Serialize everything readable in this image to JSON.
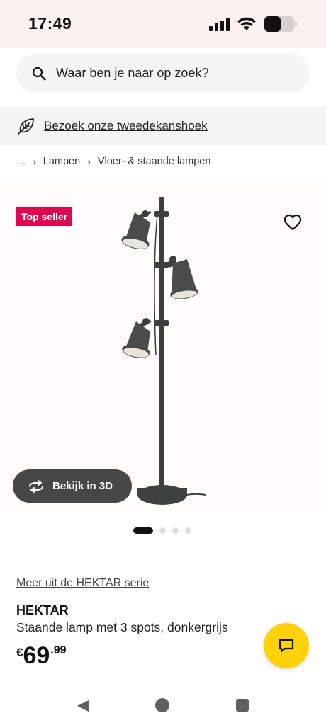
{
  "status_bar": {
    "time": "17:49",
    "battery_level": 0.55
  },
  "search": {
    "placeholder": "Waar ben je naar op zoek?",
    "icon": "search-icon"
  },
  "circular_banner": {
    "label": "Bezoek onze tweedekanshoek",
    "icon": "leaf-icon"
  },
  "breadcrumb": {
    "ellipsis": "...",
    "items": [
      "Lampen",
      "Vloer- & staande lampen"
    ],
    "separator": "›"
  },
  "gallery": {
    "badge": "Top seller",
    "badge_color": "#e00751",
    "favorite_icon": "heart-icon",
    "view_3d_label": "Bekijk in 3D",
    "view_3d_icon": "rotate-icon",
    "image_count": 4,
    "active_index": 0
  },
  "product": {
    "series_link": "Meer uit de HEKTAR serie",
    "name": "HEKTAR",
    "description": "Staande lamp met 3 spots, donkergrijs",
    "price_currency": "€",
    "price_integer": "69",
    "price_decimal": ".99"
  },
  "chat": {
    "icon": "chat-icon",
    "color": "#fdd20a"
  },
  "nav": {
    "back_icon": "back-icon",
    "home_icon": "home-icon",
    "recents_icon": "recents-icon"
  }
}
